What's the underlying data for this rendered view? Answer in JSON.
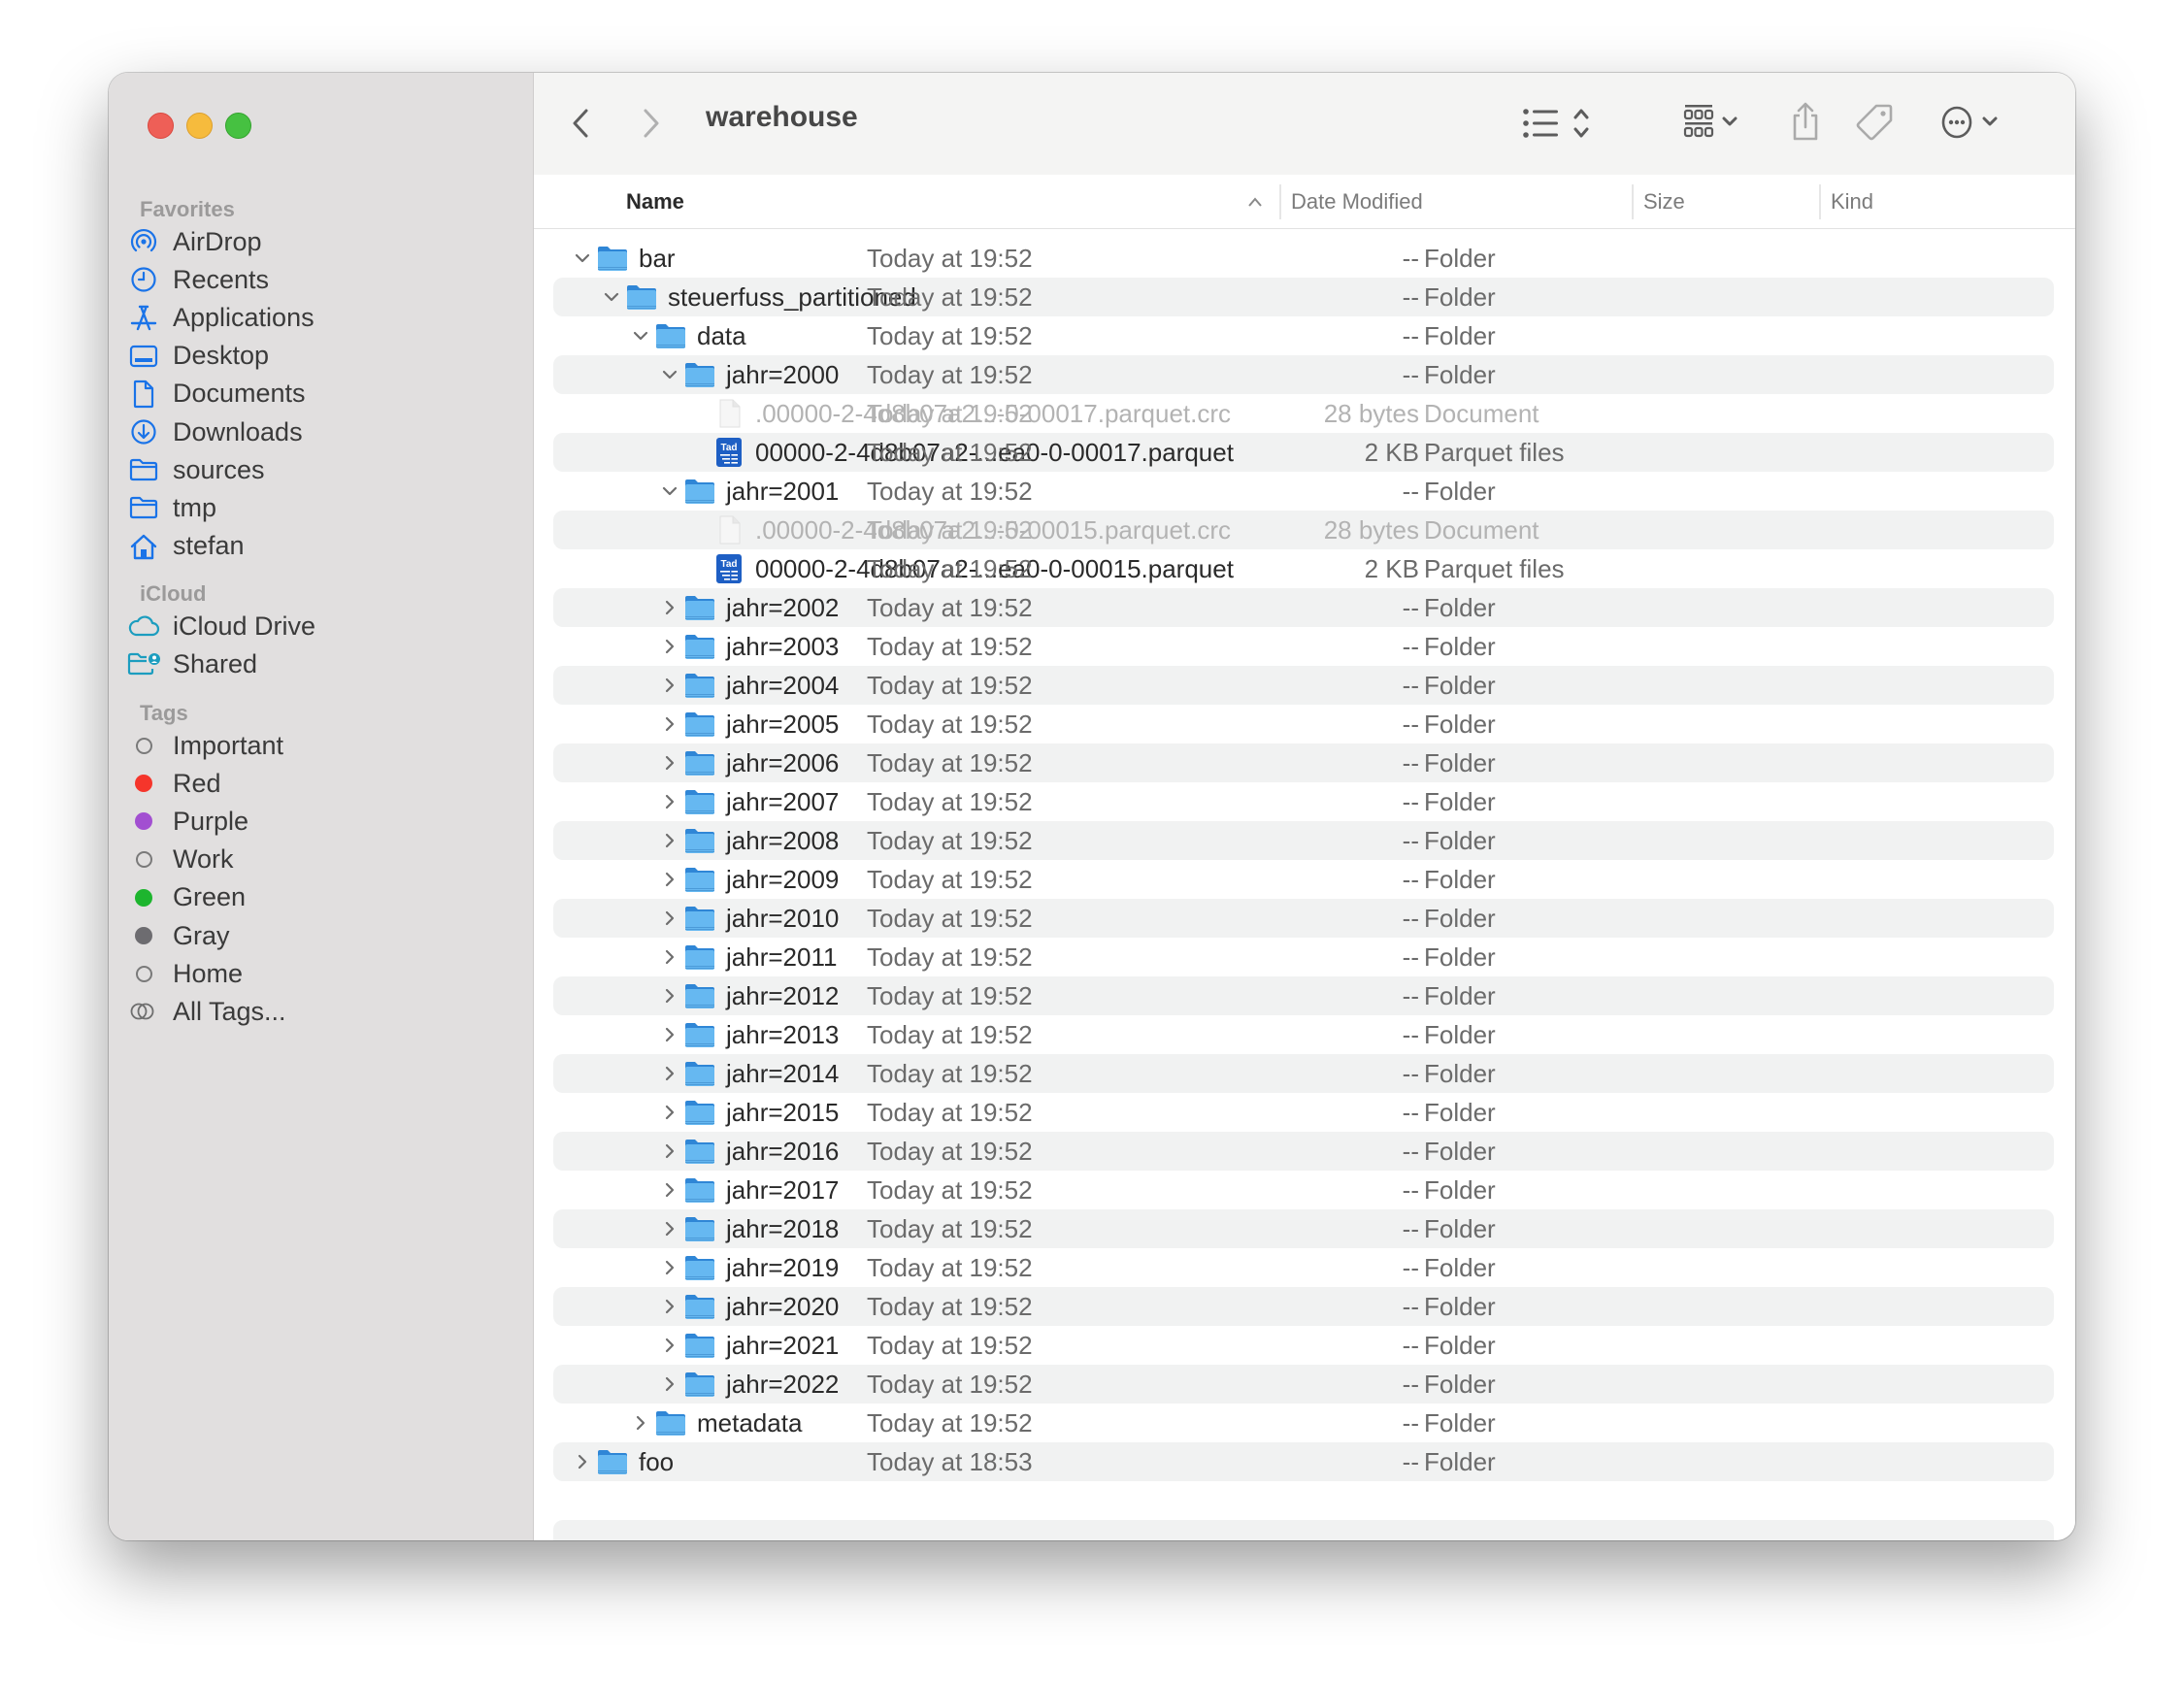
{
  "window": {
    "title": "warehouse"
  },
  "toolbar": {
    "back_label": "Back",
    "forward_label": "Forward",
    "view_list_icon": "list-view-icon",
    "group_icon": "icon-grid-icon",
    "share_icon": "share-icon",
    "tag_icon": "tag-icon",
    "more_icon": "ellipsis-circle-icon",
    "search_icon": "search-icon"
  },
  "sidebar": {
    "sections": [
      {
        "title": "Favorites",
        "items": [
          {
            "label": "AirDrop",
            "icon": "airdrop-icon"
          },
          {
            "label": "Recents",
            "icon": "clock-icon"
          },
          {
            "label": "Applications",
            "icon": "applications-icon"
          },
          {
            "label": "Desktop",
            "icon": "desktop-icon"
          },
          {
            "label": "Documents",
            "icon": "document-icon"
          },
          {
            "label": "Downloads",
            "icon": "download-icon"
          },
          {
            "label": "sources",
            "icon": "folder-icon"
          },
          {
            "label": "tmp",
            "icon": "folder-icon"
          },
          {
            "label": "stefan",
            "icon": "home-icon"
          }
        ]
      },
      {
        "title": "iCloud",
        "items": [
          {
            "label": "iCloud Drive",
            "icon": "cloud-icon"
          },
          {
            "label": "Shared",
            "icon": "shared-folder-icon"
          }
        ]
      },
      {
        "title": "Tags",
        "items": [
          {
            "label": "Important",
            "color": ""
          },
          {
            "label": "Red",
            "color": "#f5352b"
          },
          {
            "label": "Purple",
            "color": "#a24fd1"
          },
          {
            "label": "Work",
            "color": ""
          },
          {
            "label": "Green",
            "color": "#1db52e"
          },
          {
            "label": "Gray",
            "color": "#6d6c70"
          },
          {
            "label": "Home",
            "color": ""
          },
          {
            "label": "All Tags...",
            "color": "all"
          }
        ]
      }
    ]
  },
  "columns": {
    "name": "Name",
    "date": "Date Modified",
    "size": "Size",
    "kind": "Kind",
    "sort_indicator": "ascending"
  },
  "rows": [
    {
      "name": "bar",
      "level": 0,
      "type": "folder",
      "state": "expanded",
      "date": "Today at 19:52",
      "size": "--",
      "kind": "Folder"
    },
    {
      "name": "steuerfuss_partitioned",
      "level": 1,
      "type": "folder",
      "state": "expanded",
      "date": "Today at 19:52",
      "size": "--",
      "kind": "Folder"
    },
    {
      "name": "data",
      "level": 2,
      "type": "folder",
      "state": "expanded",
      "date": "Today at 19:52",
      "size": "--",
      "kind": "Folder"
    },
    {
      "name": "jahr=2000",
      "level": 3,
      "type": "folder",
      "state": "expanded",
      "date": "Today at 19:52",
      "size": "--",
      "kind": "Folder"
    },
    {
      "name": ".00000-2-4d8b07a2...-0-00017.parquet.crc",
      "level": 4,
      "type": "document",
      "state": "none",
      "dim": true,
      "date": "Today at 19:52",
      "size": "28 bytes",
      "kind": "Document"
    },
    {
      "name": "00000-2-4d8b07a2-...ea0-0-00017.parquet",
      "level": 4,
      "type": "parquet",
      "state": "none",
      "date": "Today at 19:52",
      "size": "2 KB",
      "kind": "Parquet files"
    },
    {
      "name": "jahr=2001",
      "level": 3,
      "type": "folder",
      "state": "expanded",
      "date": "Today at 19:52",
      "size": "--",
      "kind": "Folder"
    },
    {
      "name": ".00000-2-4d8b07a2...-0-00015.parquet.crc",
      "level": 4,
      "type": "document",
      "state": "none",
      "dim": true,
      "date": "Today at 19:52",
      "size": "28 bytes",
      "kind": "Document"
    },
    {
      "name": "00000-2-4d8b07a2-...ea0-0-00015.parquet",
      "level": 4,
      "type": "parquet",
      "state": "none",
      "date": "Today at 19:52",
      "size": "2 KB",
      "kind": "Parquet files"
    },
    {
      "name": "jahr=2002",
      "level": 3,
      "type": "folder",
      "state": "collapsed",
      "date": "Today at 19:52",
      "size": "--",
      "kind": "Folder"
    },
    {
      "name": "jahr=2003",
      "level": 3,
      "type": "folder",
      "state": "collapsed",
      "date": "Today at 19:52",
      "size": "--",
      "kind": "Folder"
    },
    {
      "name": "jahr=2004",
      "level": 3,
      "type": "folder",
      "state": "collapsed",
      "date": "Today at 19:52",
      "size": "--",
      "kind": "Folder"
    },
    {
      "name": "jahr=2005",
      "level": 3,
      "type": "folder",
      "state": "collapsed",
      "date": "Today at 19:52",
      "size": "--",
      "kind": "Folder"
    },
    {
      "name": "jahr=2006",
      "level": 3,
      "type": "folder",
      "state": "collapsed",
      "date": "Today at 19:52",
      "size": "--",
      "kind": "Folder"
    },
    {
      "name": "jahr=2007",
      "level": 3,
      "type": "folder",
      "state": "collapsed",
      "date": "Today at 19:52",
      "size": "--",
      "kind": "Folder"
    },
    {
      "name": "jahr=2008",
      "level": 3,
      "type": "folder",
      "state": "collapsed",
      "date": "Today at 19:52",
      "size": "--",
      "kind": "Folder"
    },
    {
      "name": "jahr=2009",
      "level": 3,
      "type": "folder",
      "state": "collapsed",
      "date": "Today at 19:52",
      "size": "--",
      "kind": "Folder"
    },
    {
      "name": "jahr=2010",
      "level": 3,
      "type": "folder",
      "state": "collapsed",
      "date": "Today at 19:52",
      "size": "--",
      "kind": "Folder"
    },
    {
      "name": "jahr=2011",
      "level": 3,
      "type": "folder",
      "state": "collapsed",
      "date": "Today at 19:52",
      "size": "--",
      "kind": "Folder"
    },
    {
      "name": "jahr=2012",
      "level": 3,
      "type": "folder",
      "state": "collapsed",
      "date": "Today at 19:52",
      "size": "--",
      "kind": "Folder"
    },
    {
      "name": "jahr=2013",
      "level": 3,
      "type": "folder",
      "state": "collapsed",
      "date": "Today at 19:52",
      "size": "--",
      "kind": "Folder"
    },
    {
      "name": "jahr=2014",
      "level": 3,
      "type": "folder",
      "state": "collapsed",
      "date": "Today at 19:52",
      "size": "--",
      "kind": "Folder"
    },
    {
      "name": "jahr=2015",
      "level": 3,
      "type": "folder",
      "state": "collapsed",
      "date": "Today at 19:52",
      "size": "--",
      "kind": "Folder"
    },
    {
      "name": "jahr=2016",
      "level": 3,
      "type": "folder",
      "state": "collapsed",
      "date": "Today at 19:52",
      "size": "--",
      "kind": "Folder"
    },
    {
      "name": "jahr=2017",
      "level": 3,
      "type": "folder",
      "state": "collapsed",
      "date": "Today at 19:52",
      "size": "--",
      "kind": "Folder"
    },
    {
      "name": "jahr=2018",
      "level": 3,
      "type": "folder",
      "state": "collapsed",
      "date": "Today at 19:52",
      "size": "--",
      "kind": "Folder"
    },
    {
      "name": "jahr=2019",
      "level": 3,
      "type": "folder",
      "state": "collapsed",
      "date": "Today at 19:52",
      "size": "--",
      "kind": "Folder"
    },
    {
      "name": "jahr=2020",
      "level": 3,
      "type": "folder",
      "state": "collapsed",
      "date": "Today at 19:52",
      "size": "--",
      "kind": "Folder"
    },
    {
      "name": "jahr=2021",
      "level": 3,
      "type": "folder",
      "state": "collapsed",
      "date": "Today at 19:52",
      "size": "--",
      "kind": "Folder"
    },
    {
      "name": "jahr=2022",
      "level": 3,
      "type": "folder",
      "state": "collapsed",
      "date": "Today at 19:52",
      "size": "--",
      "kind": "Folder"
    },
    {
      "name": "metadata",
      "level": 2,
      "type": "folder",
      "state": "collapsed",
      "date": "Today at 19:52",
      "size": "--",
      "kind": "Folder"
    },
    {
      "name": "foo",
      "level": 0,
      "type": "folder",
      "state": "collapsed",
      "date": "Today at 18:53",
      "size": "--",
      "kind": "Folder"
    }
  ],
  "colors": {
    "accent": "#1a73e8",
    "folder_blue": "#5eb4f0",
    "icloud_teal": "#1c9dbf"
  }
}
